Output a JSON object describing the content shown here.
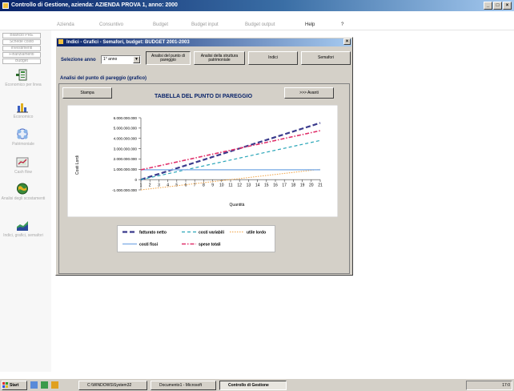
{
  "window": {
    "title": "Controllo di Gestione,  azienda: AZIENDA PROVA 1, anno: 2000",
    "controls": [
      "_",
      "□",
      "×"
    ]
  },
  "menu": [
    "Azienda",
    "Consuntivo",
    "Budget",
    "Budget input",
    "Budget output",
    "Help",
    "?"
  ],
  "sidebar": {
    "buttons": [
      "Bilancio PRE",
      "Schede costo",
      "Investimenti",
      "Finanziamenti",
      "Budget"
    ],
    "items": [
      {
        "label": "Economico per linea",
        "icon": "ledger-icon"
      },
      {
        "label": "Economico",
        "icon": "bar-chart-icon"
      },
      {
        "label": "Patrimoniale",
        "icon": "balance-icon"
      },
      {
        "label": "Cash flow",
        "icon": "cash-flow-icon"
      },
      {
        "label": "Analisi degli scostamenti",
        "icon": "globe-icon"
      },
      {
        "label": "Indici, grafici, semafori",
        "icon": "graph-icon"
      }
    ]
  },
  "dialog": {
    "title": "Indici - Grafici - Semafori, budget: BUDGET 2001-2003",
    "close": "×",
    "year_label": "Selezione anno",
    "year_value": "1° anno",
    "tabs": [
      "Analisi del punto di pareggio",
      "Analisi della struttura patrimoniale",
      "Indici",
      "Semafori"
    ],
    "section_label": "Analisi del punto di pareggio (grafico)",
    "print_button": "Stampa",
    "next_button": ">>> Avanti",
    "chart_title": "TABELLA DEL PUNTO DI PAREGGIO"
  },
  "chart_data": {
    "type": "line",
    "x": [
      1,
      2,
      3,
      4,
      5,
      6,
      7,
      8,
      9,
      10,
      11,
      12,
      13,
      14,
      15,
      16,
      17,
      18,
      19,
      20,
      21
    ],
    "xlabel": "Quantità",
    "ylabel": "Costi Lordi",
    "ylim": [
      -1000000,
      6000000
    ],
    "yticks": [
      "6.000.000.000",
      "5.000.000.000",
      "4.000.000.000",
      "3.000.000.000",
      "2.000.000.000",
      "1.000.000.000",
      "0",
      "-1.000.000.000"
    ],
    "ytick_values": [
      6000000,
      5000000,
      4000000,
      3000000,
      2000000,
      1000000,
      0,
      -1000000
    ],
    "series": [
      {
        "name": "fatturato netto",
        "color": "#3a3a8c",
        "dash": "6,3",
        "width": 2.2,
        "start": 0,
        "end": 5500000
      },
      {
        "name": "costi variabili",
        "color": "#2aa6b8",
        "dash": "4,3",
        "width": 1.2,
        "start": 0,
        "end": 3800000
      },
      {
        "name": "utile lordo",
        "color": "#f0a040",
        "dash": "1.5,1.5",
        "width": 1,
        "start": -1000000,
        "end": 1000000
      },
      {
        "name": "costi fissi",
        "color": "#8ab4e8",
        "dash": "",
        "width": 1.5,
        "start": 950000,
        "end": 950000
      },
      {
        "name": "spese totali",
        "color": "#e0306a",
        "dash": "5,2,1.5,2",
        "width": 1.6,
        "start": 950000,
        "end": 4750000
      }
    ],
    "legend": "bottom"
  },
  "taskbar": {
    "start": "Start",
    "tasks": [
      "C:\\WINDOWS\\System32",
      "Documento1 - Microsoft",
      "Controllo di Gestione"
    ],
    "clock": "17:0"
  }
}
